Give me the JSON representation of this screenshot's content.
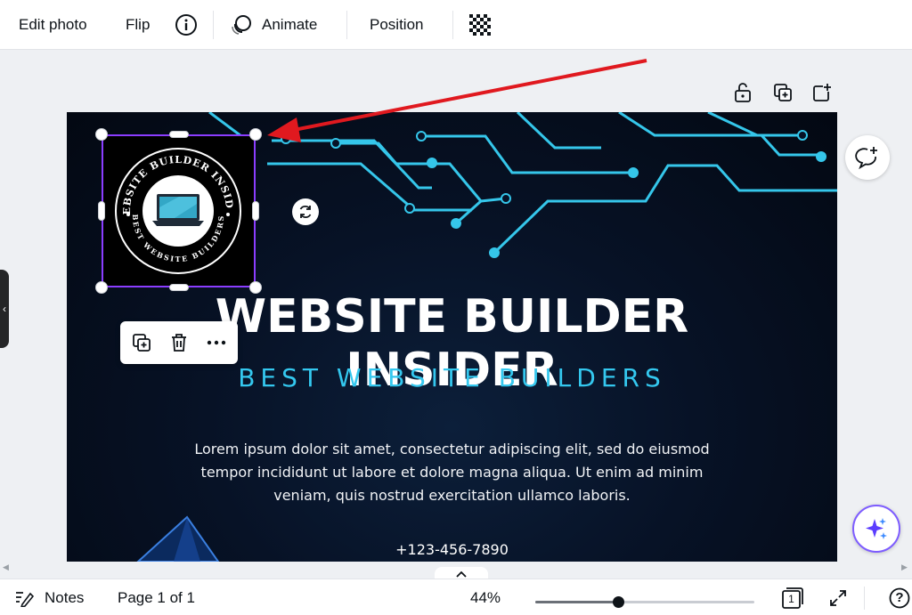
{
  "toolbar": {
    "edit_photo": "Edit photo",
    "flip": "Flip",
    "animate": "Animate",
    "position": "Position"
  },
  "design": {
    "logo_top_text": "WEBSITE BUILDER INSIDER",
    "logo_bottom_text": "BEST WEBSITE BUILDERS",
    "headline": "WEBSITE BUILDER INSIDER",
    "subhead": "BEST WEBSITE BUILDERS",
    "body": "Lorem ipsum dolor sit amet, consectetur adipiscing elit, sed do eiusmod tempor incididunt ut labore et dolore magna aliqua. Ut enim ad minim veniam, quis nostrud exercitation ullamco laboris.",
    "phone": "+123-456-7890"
  },
  "bottombar": {
    "notes": "Notes",
    "page_indicator": "Page 1 of 1",
    "zoom_level": "44%",
    "zoom_fraction": 0.38,
    "page_count_badge": "1",
    "help": "?"
  },
  "colors": {
    "selection": "#8b3dff",
    "circuit": "#35c6ea",
    "annotation_arrow": "#e0191f"
  },
  "icons": {
    "info": "info-icon",
    "animate": "animate-icon",
    "transparency": "transparency-icon",
    "lock": "lock-icon",
    "duplicate": "duplicate-page-icon",
    "add_page": "add-page-icon",
    "comment": "add-comment-icon",
    "rotate": "rotate-icon",
    "magic": "magic-sparkle-icon"
  }
}
